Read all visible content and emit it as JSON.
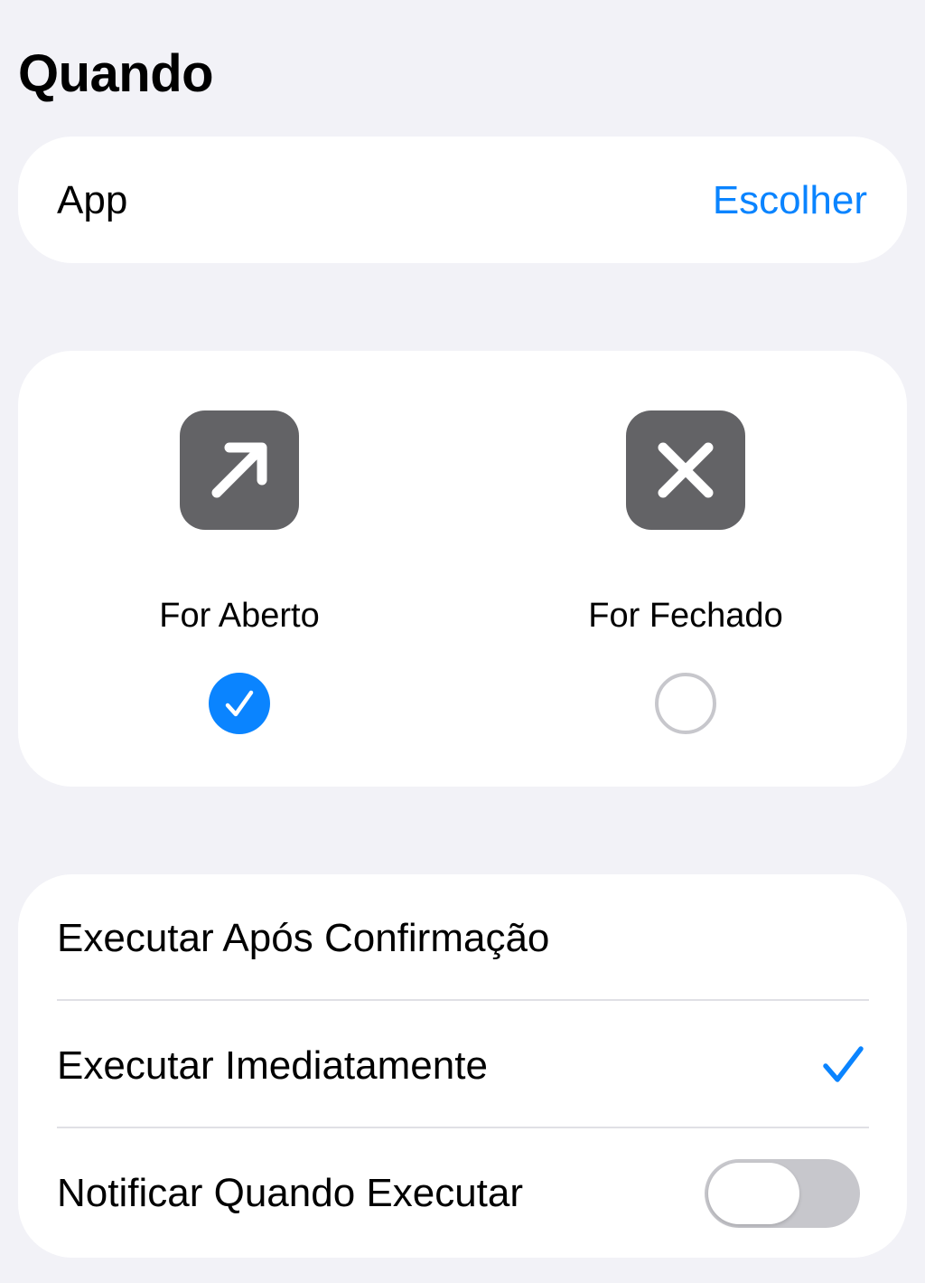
{
  "section": {
    "title": "Quando"
  },
  "app_row": {
    "label": "App",
    "action_label": "Escolher"
  },
  "states": [
    {
      "label": "For Aberto",
      "icon": "arrow-up-right-icon",
      "selected": true
    },
    {
      "label": "For Fechado",
      "icon": "x-mark-icon",
      "selected": false
    }
  ],
  "options": [
    {
      "label": "Executar Após Confirmação",
      "selected": false
    },
    {
      "label": "Executar Imediatamente",
      "selected": true
    },
    {
      "label": "Notificar Quando Executar",
      "toggle_on": false
    }
  ],
  "colors": {
    "accent": "#0a84ff",
    "background": "#f2f2f7",
    "card": "#ffffff",
    "icon_tile": "#636366",
    "toggle_off": "#c7c7cc"
  }
}
